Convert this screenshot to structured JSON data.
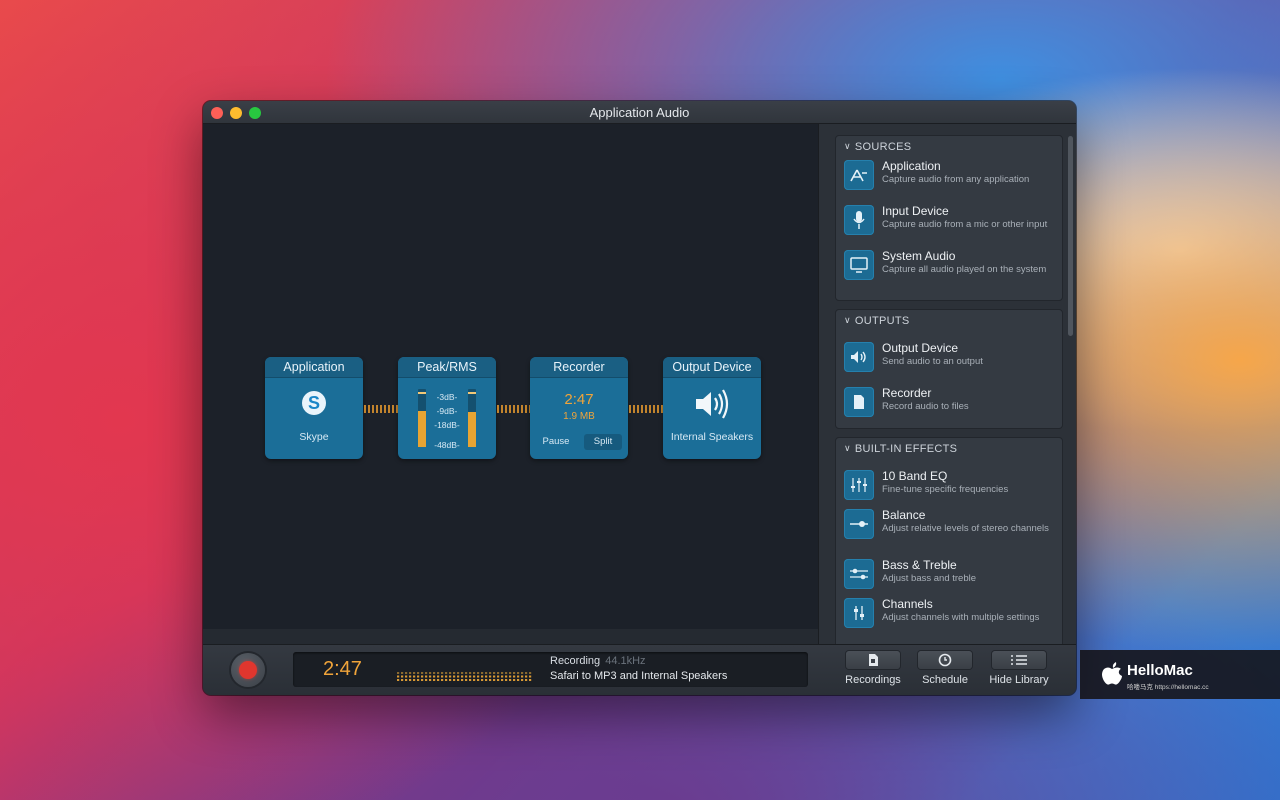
{
  "window": {
    "title": "Application Audio"
  },
  "flow": {
    "application": {
      "title": "Application",
      "caption": "Skype",
      "icon": "skype-icon"
    },
    "peak_rms": {
      "title": "Peak/RMS",
      "db_labels": [
        "-3dB-",
        "-9dB-",
        "-18dB-",
        "-48dB-"
      ],
      "left_level": 0.62,
      "right_level": 0.6
    },
    "recorder": {
      "title": "Recorder",
      "time": "2:47",
      "size": "1.9 MB",
      "pause_label": "Pause",
      "split_label": "Split"
    },
    "output": {
      "title": "Output Device",
      "caption": "Internal Speakers",
      "icon": "speaker-icon"
    }
  },
  "sidebar": {
    "sources": {
      "header": "SOURCES",
      "items": [
        {
          "title": "Application",
          "desc": "Capture audio from any application",
          "icon": "app-store-icon"
        },
        {
          "title": "Input Device",
          "desc": "Capture audio from a mic or other input",
          "icon": "microphone-icon"
        },
        {
          "title": "System Audio",
          "desc": "Capture all audio played on the system",
          "icon": "monitor-icon"
        }
      ]
    },
    "outputs": {
      "header": "OUTPUTS",
      "items": [
        {
          "title": "Output Device",
          "desc": "Send audio to an output",
          "icon": "speaker-icon"
        },
        {
          "title": "Recorder",
          "desc": "Record audio to files",
          "icon": "file-icon"
        }
      ]
    },
    "effects": {
      "header": "BUILT-IN EFFECTS",
      "items": [
        {
          "title": "10 Band EQ",
          "desc": "Fine-tune specific frequencies",
          "icon": "eq-sliders-icon"
        },
        {
          "title": "Balance",
          "desc": "Adjust relative levels of stereo channels",
          "icon": "balance-slider-icon"
        },
        {
          "title": "Bass & Treble",
          "desc": "Adjust bass and treble",
          "icon": "bass-treble-icon"
        },
        {
          "title": "Channels",
          "desc": "Adjust channels with multiple settings",
          "icon": "channels-icon"
        }
      ]
    }
  },
  "bottom": {
    "time": "2:47",
    "status": "Recording",
    "rate": "44.1kHz",
    "route": "Safari to MP3 and Internal Speakers",
    "tools": {
      "recordings": "Recordings",
      "schedule": "Schedule",
      "hide_library": "Hide Library"
    }
  },
  "watermark": {
    "name": "HelloMac",
    "url": "哈喽马克 https://hellomac.cc"
  },
  "colors": {
    "accent": "#1b6e98",
    "orange": "#f0a43a",
    "record": "#e0362e"
  }
}
